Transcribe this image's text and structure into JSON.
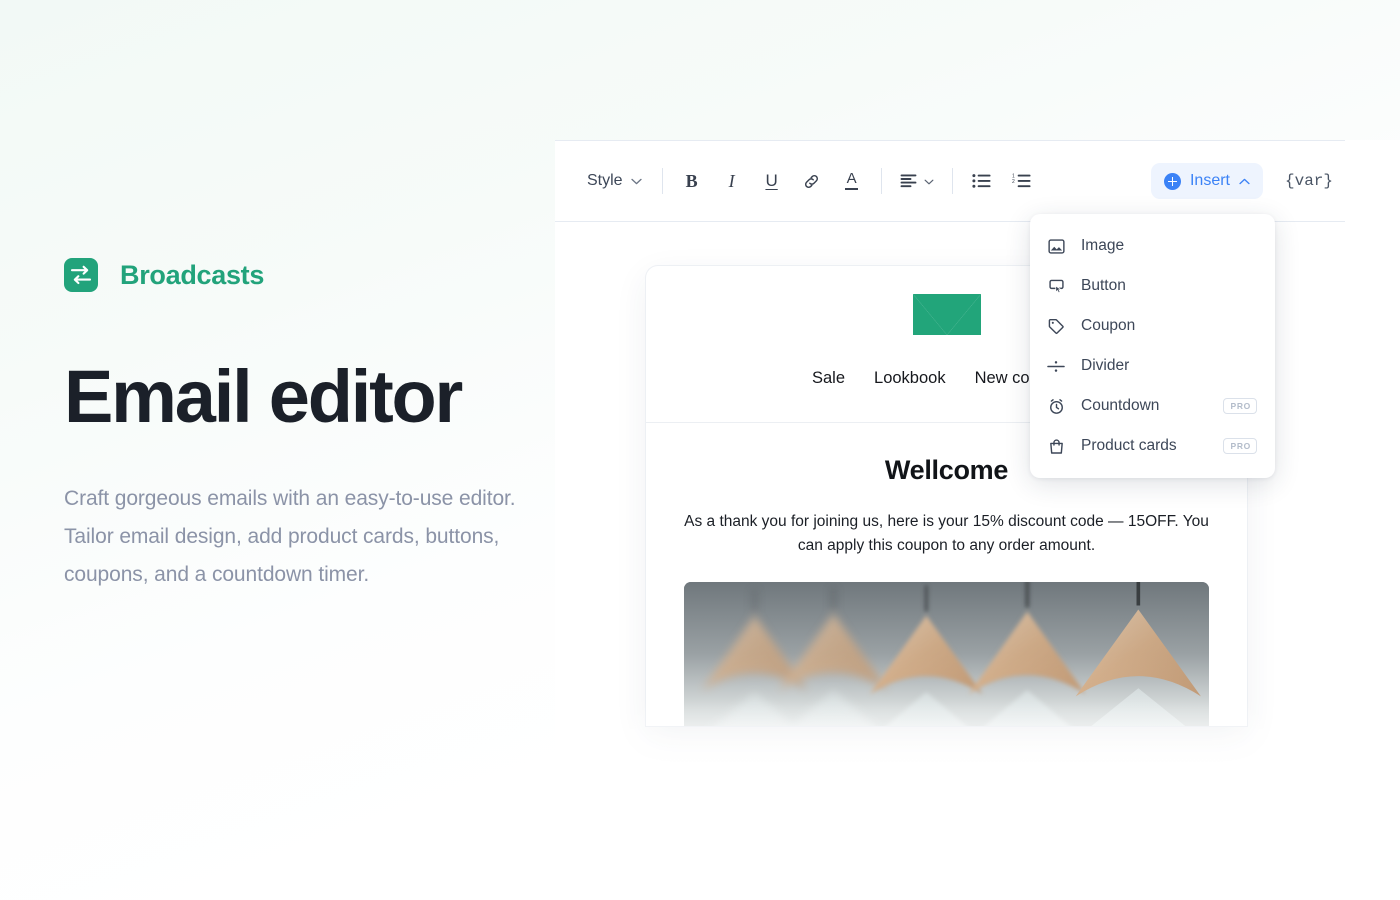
{
  "hero": {
    "brand_name": "Broadcasts",
    "brand_icon": "exchange-loop-icon",
    "title": "Email editor",
    "subtitle": "Craft gorgeous emails with an easy-to-use editor. Tailor email design, add product cards, buttons, coupons, and a countdown timer.",
    "brand_color": "#22a37b",
    "title_color": "#1b2029",
    "subtitle_color": "#8b93a7"
  },
  "toolbar": {
    "style_label": "Style",
    "style_caret": "chevron-down-icon",
    "bold_label": "B",
    "italic_label": "I",
    "underline_label": "U",
    "link_icon": "link-icon",
    "text_color_label": "A",
    "align_icon": "align-left-icon",
    "align_caret": "chevron-down-icon",
    "bullet_list_icon": "bullet-list-icon",
    "numbered_list_icon": "numbered-list-icon",
    "insert_label": "Insert",
    "insert_icon": "plus-circle-icon",
    "insert_caret": "chevron-up-icon",
    "variable_token": "{var}",
    "accent_color": "#3b82f6",
    "accent_bg": "#eef4fe"
  },
  "insert_menu": {
    "items": [
      {
        "label": "Image",
        "icon": "image-icon",
        "badge": ""
      },
      {
        "label": "Button",
        "icon": "button-icon",
        "badge": ""
      },
      {
        "label": "Coupon",
        "icon": "tag-icon",
        "badge": ""
      },
      {
        "label": "Divider",
        "icon": "divider-icon",
        "badge": ""
      },
      {
        "label": "Countdown",
        "icon": "alarm-clock-icon",
        "badge": "PRO"
      },
      {
        "label": "Product cards",
        "icon": "shopping-bag-icon",
        "badge": "PRO"
      }
    ]
  },
  "email_preview": {
    "logo_icon": "m-envelope-logo",
    "logo_color": "#22a57a",
    "nav": [
      "Sale",
      "Lookbook",
      "New collection"
    ],
    "heading": "Wellcome",
    "paragraph": "As a thank you for joining us, here is your 15% discount code — 15OFF. You can apply this coupon to any order amount.",
    "image_alt": "wooden clothes hangers on a rail"
  }
}
